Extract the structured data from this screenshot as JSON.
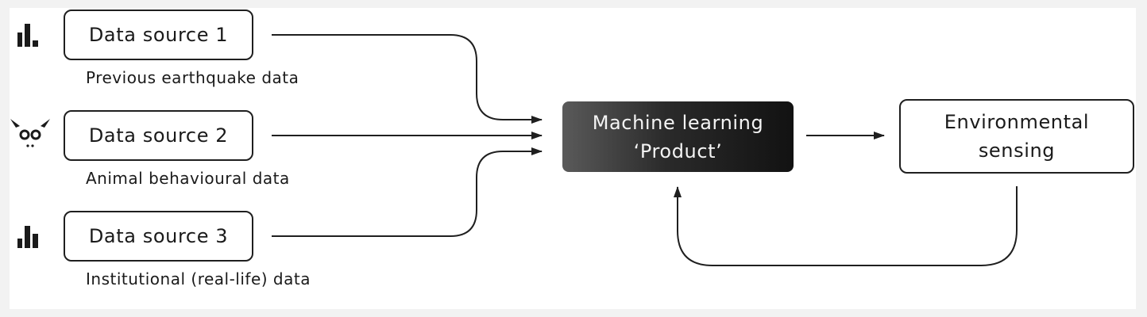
{
  "sources": [
    {
      "label": "Data source 1",
      "description": "Previous earthquake data",
      "icon": "bar-chart-icon"
    },
    {
      "label": "Data source 2",
      "description": "Animal behavioural data",
      "icon": "owl-icon"
    },
    {
      "label": "Data source 3",
      "description": "Institutional (real-life) data",
      "icon": "bar-chart-icon"
    }
  ],
  "ml_product": {
    "line1": "Machine learning",
    "line2": "‘Product’"
  },
  "environmental": {
    "line1": "Environmental",
    "line2": "sensing"
  },
  "colors": {
    "stroke": "#1f1f1f",
    "ml_box_start": "#5a5a5a",
    "ml_box_end": "#121212",
    "background": "#ffffff"
  }
}
